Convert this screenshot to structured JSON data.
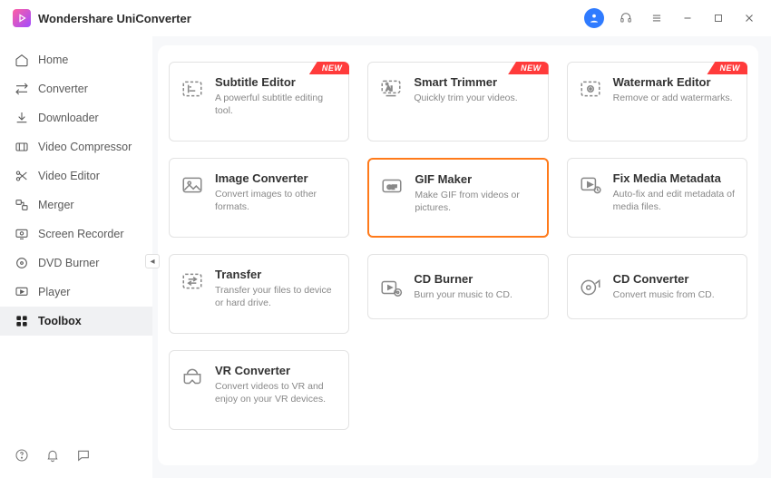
{
  "app": {
    "title": "Wondershare UniConverter"
  },
  "badge": {
    "new": "NEW"
  },
  "sidebar": {
    "items": [
      {
        "label": "Home"
      },
      {
        "label": "Converter"
      },
      {
        "label": "Downloader"
      },
      {
        "label": "Video Compressor"
      },
      {
        "label": "Video Editor"
      },
      {
        "label": "Merger"
      },
      {
        "label": "Screen Recorder"
      },
      {
        "label": "DVD Burner"
      },
      {
        "label": "Player"
      },
      {
        "label": "Toolbox"
      }
    ]
  },
  "tools": [
    {
      "title": "Subtitle Editor",
      "desc": "A powerful subtitle editing tool.",
      "new": true
    },
    {
      "title": "Smart Trimmer",
      "desc": "Quickly trim your videos.",
      "new": true
    },
    {
      "title": "Watermark Editor",
      "desc": "Remove or add watermarks.",
      "new": true
    },
    {
      "title": "Image Converter",
      "desc": "Convert images to other formats."
    },
    {
      "title": "GIF Maker",
      "desc": "Make GIF from videos or pictures.",
      "selected": true
    },
    {
      "title": "Fix Media Metadata",
      "desc": "Auto-fix and edit metadata of media files."
    },
    {
      "title": "Transfer",
      "desc": "Transfer your files to device or hard drive."
    },
    {
      "title": "CD Burner",
      "desc": "Burn your music to CD."
    },
    {
      "title": "CD Converter",
      "desc": "Convert music from CD."
    },
    {
      "title": "VR Converter",
      "desc": "Convert videos to VR and enjoy on your VR devices."
    }
  ]
}
